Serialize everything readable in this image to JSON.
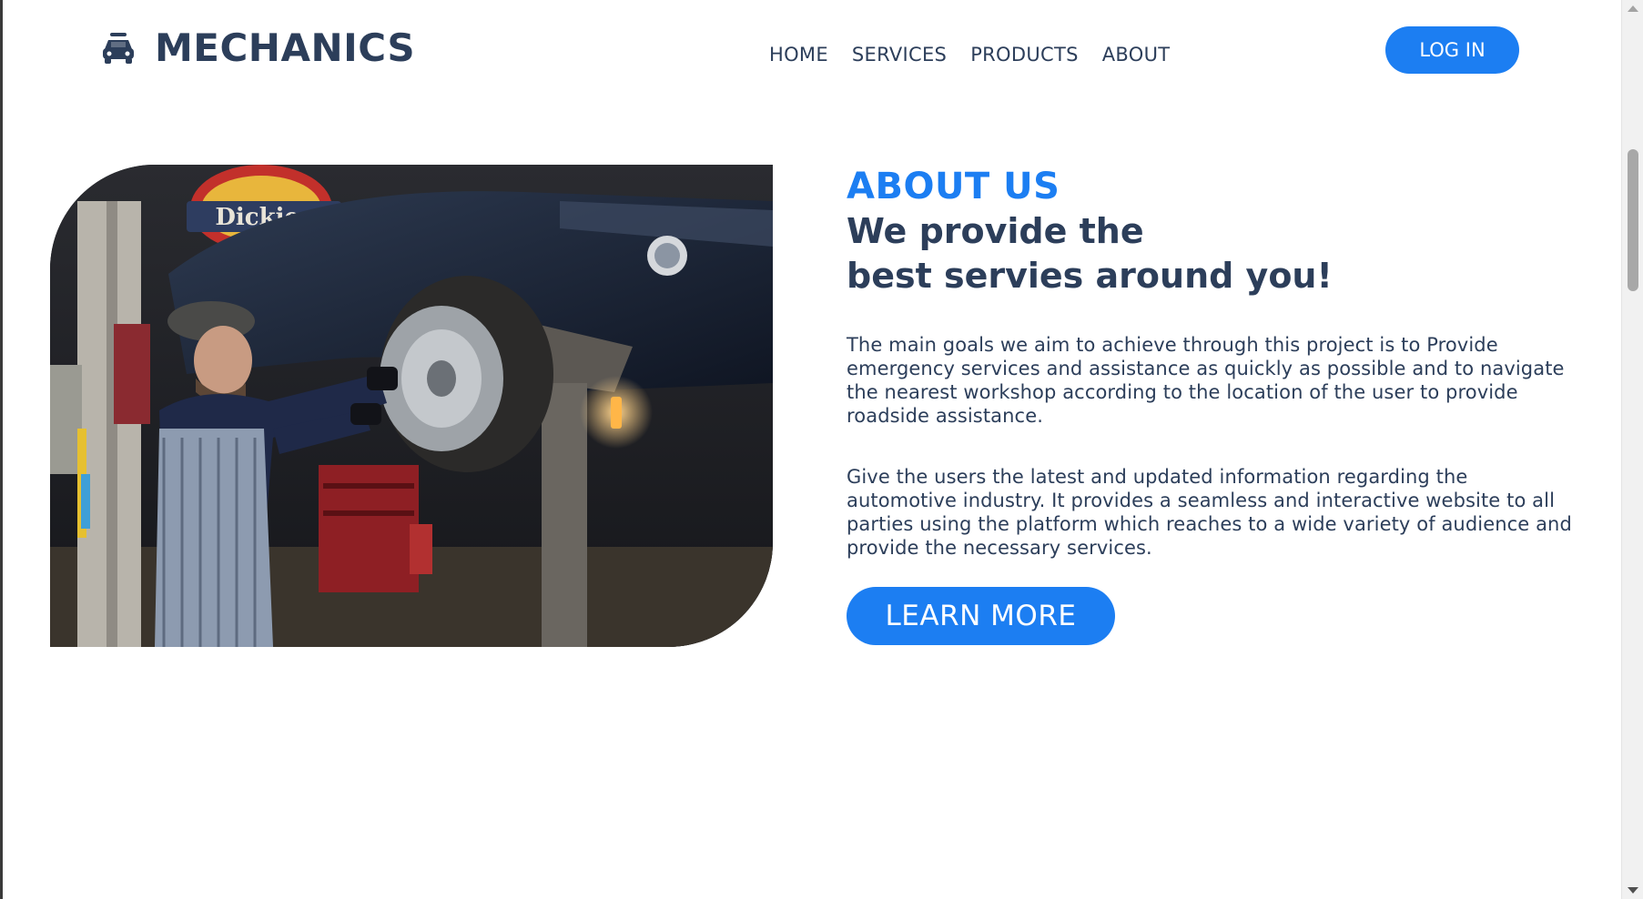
{
  "header": {
    "brand": "MECHANICS",
    "logo_icon": "car-icon",
    "nav": [
      {
        "label": "HOME"
      },
      {
        "label": "SERVICES"
      },
      {
        "label": "PRODUCTS"
      },
      {
        "label": "ABOUT"
      }
    ],
    "login_label": "LOG IN"
  },
  "about": {
    "kicker": "ABOUT US",
    "heading_line1": "We provide the",
    "heading_line2": "best servies around you!",
    "paragraph1": "The main goals we aim to achieve through this project is to Provide emergency services and assistance as quickly as possible and to navigate the nearest workshop according to the location of the user to provide roadside assistance.",
    "paragraph2": "Give the users the latest and updated information regarding the automotive industry. It provides a seamless and interactive website to all parties using the platform which reaches to a wide variety of audience and provide the necessary services.",
    "button_label": "LEARN MORE"
  },
  "photo": {
    "sign_text": "Dickies"
  },
  "colors": {
    "accent": "#1c7ef2",
    "text": "#2c3e5a",
    "background": "#ffffff"
  }
}
